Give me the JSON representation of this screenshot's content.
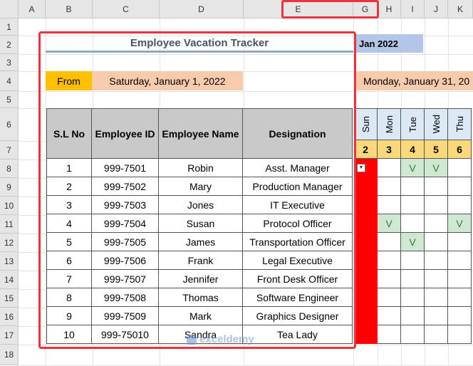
{
  "columns": [
    "A",
    "B",
    "C",
    "D",
    "E",
    "G",
    "H",
    "I",
    "J",
    "K"
  ],
  "rows": [
    "1",
    "2",
    "3",
    "4",
    "5",
    "6",
    "7",
    "8",
    "9",
    "10",
    "11",
    "12",
    "13",
    "14",
    "15",
    "16",
    "17",
    "18"
  ],
  "title": "Employee Vacation Tracker",
  "month_label": "Jan 2022",
  "from_label": "From",
  "from_date": "Saturday, January 1, 2022",
  "to_date": "Monday, January 31, 20",
  "table": {
    "headers": [
      "S.L No",
      "Employee ID",
      "Employee Name",
      "Designation"
    ],
    "rows": [
      [
        "1",
        "999-7501",
        "Robin",
        "Asst. Manager"
      ],
      [
        "2",
        "999-7502",
        "Mary",
        "Production Manager"
      ],
      [
        "3",
        "999-7503",
        "Jones",
        "IT Executive"
      ],
      [
        "4",
        "999-7504",
        "Susan",
        "Protocol Officer"
      ],
      [
        "5",
        "999-7505",
        "James",
        "Transportation Officer"
      ],
      [
        "6",
        "999-7506",
        "Frank",
        "Legal Executive"
      ],
      [
        "7",
        "999-7507",
        "Jennifer",
        "Front Desk Officer"
      ],
      [
        "8",
        "999-7508",
        "Thomas",
        "Software Engineer"
      ],
      [
        "9",
        "999-7509",
        "Mark",
        "Graphics Designer"
      ],
      [
        "10",
        "999-75010",
        "Sandra",
        "Tea Lady"
      ]
    ]
  },
  "days": [
    "Sun",
    "Mon",
    "Tue",
    "Wed",
    "Thu"
  ],
  "day_numbers": [
    "2",
    "3",
    "4",
    "5",
    "6"
  ],
  "vacation_mark": "V",
  "watermark": "exceldemy",
  "colors": {
    "accent_red": "#e8343a",
    "from_bg": "#ffc000",
    "date_bg": "#f8cbad",
    "month_bg": "#b4c6e7",
    "day_hdr": "#dbe9f7",
    "day_num": "#fbd97a",
    "vacation": "#cfe8d2"
  }
}
